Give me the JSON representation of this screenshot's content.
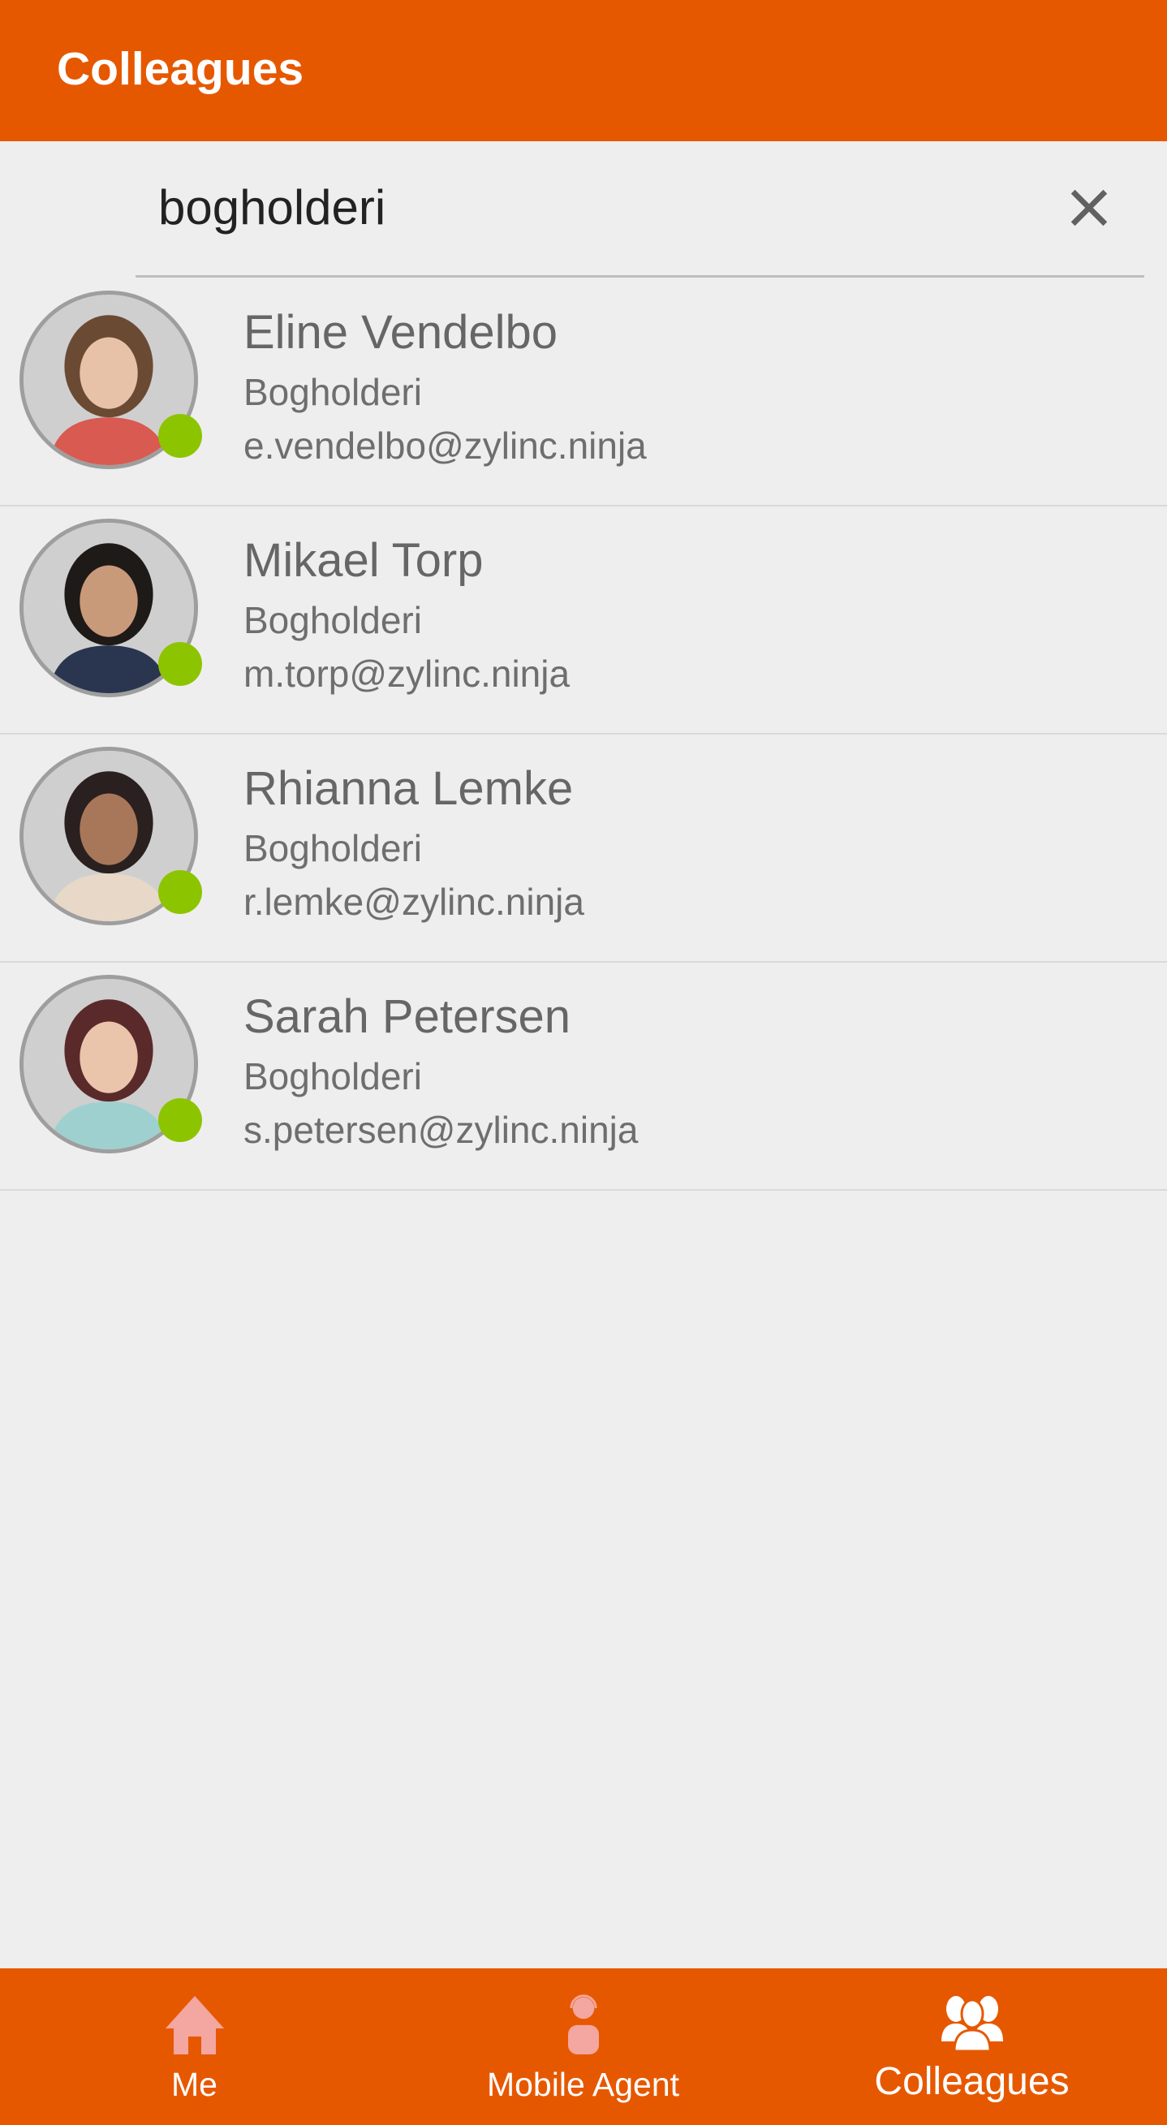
{
  "header": {
    "title": "Colleagues"
  },
  "search": {
    "value": "bogholderi",
    "icon": "search-icon",
    "clear_icon": "close-icon"
  },
  "colleagues": [
    {
      "name": "Eline Vendelbo",
      "department": "Bogholderi",
      "email": "e.vendelbo@zylinc.ninja",
      "status": "online"
    },
    {
      "name": "Mikael Torp",
      "department": "Bogholderi",
      "email": "m.torp@zylinc.ninja",
      "status": "online"
    },
    {
      "name": "Rhianna Lemke",
      "department": "Bogholderi",
      "email": "r.lemke@zylinc.ninja",
      "status": "online"
    },
    {
      "name": "Sarah Petersen",
      "department": "Bogholderi",
      "email": "s.petersen@zylinc.ninja",
      "status": "online"
    }
  ],
  "nav": {
    "items": [
      {
        "label": "Me",
        "icon": "home-icon"
      },
      {
        "label": "Mobile Agent",
        "icon": "headset-agent-icon"
      },
      {
        "label": "Colleagues",
        "icon": "people-icon",
        "active": true
      }
    ]
  },
  "colors": {
    "brand": "#e65800",
    "online": "#8dc400"
  }
}
